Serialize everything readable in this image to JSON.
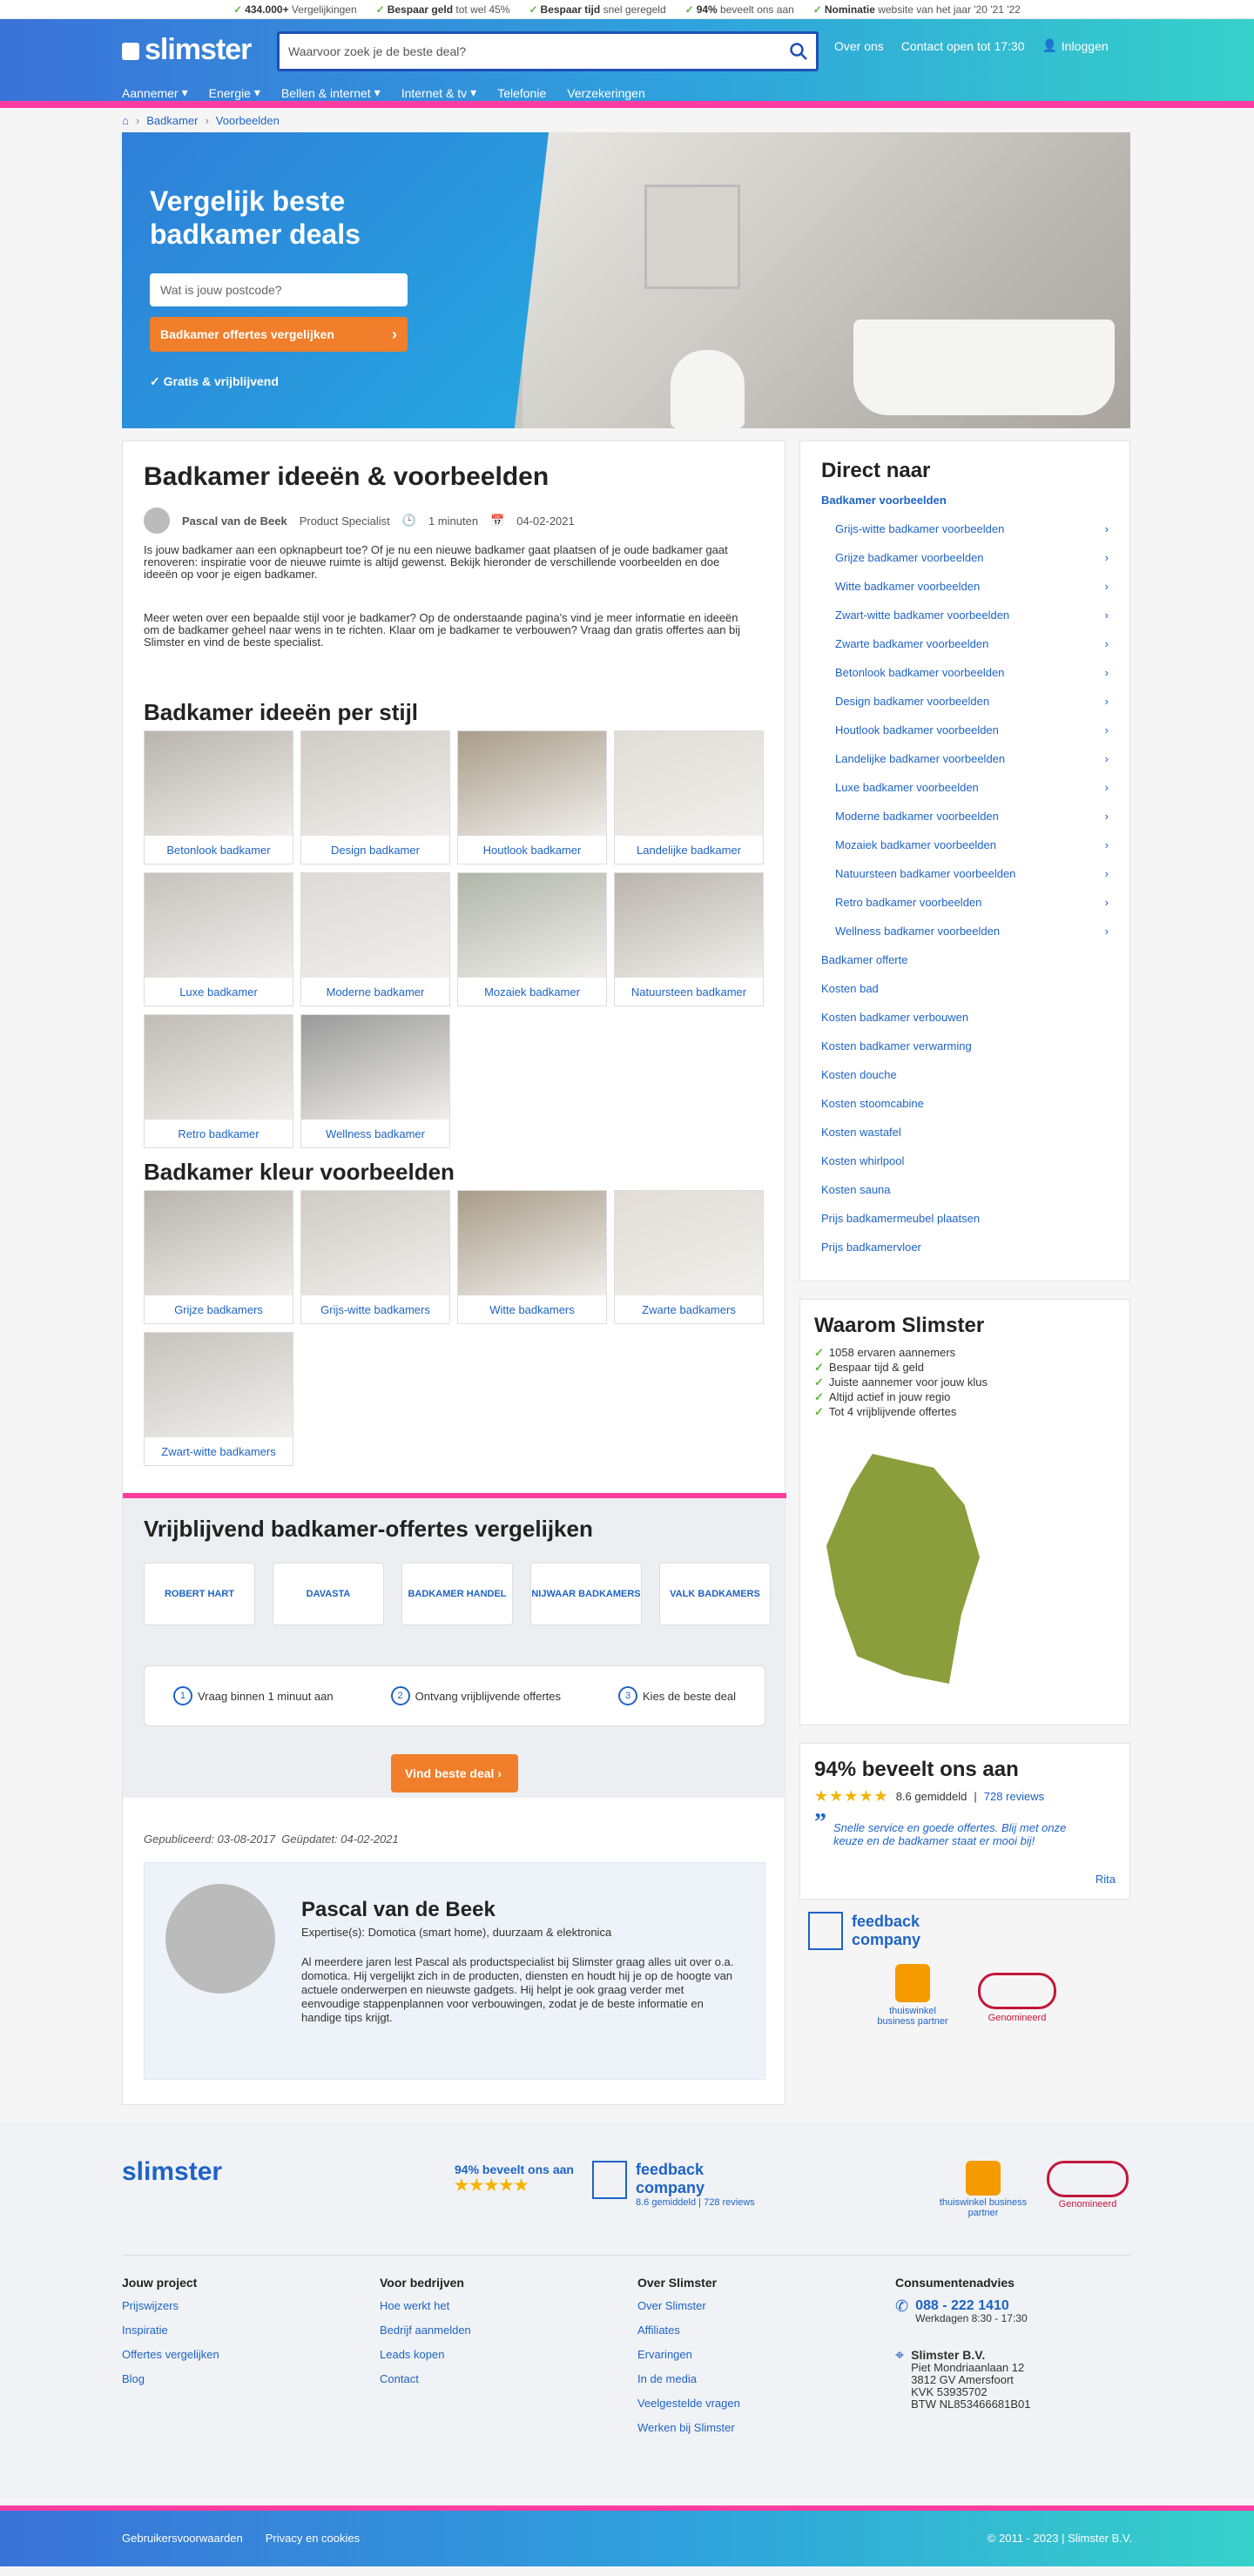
{
  "topbar": [
    {
      "bold": "434.000+",
      "text": " Vergelijkingen"
    },
    {
      "bold": "Bespaar geld",
      "text": " tot wel 45%"
    },
    {
      "bold": "Bespaar tijd",
      "text": " snel geregeld"
    },
    {
      "bold": "94%",
      "text": " beveelt ons aan"
    },
    {
      "bold": "Nominatie",
      "text": " website van het jaar '20 '21 '22"
    }
  ],
  "header": {
    "logo": "slimster",
    "search_placeholder": "Waarvoor zoek je de beste deal?",
    "links": [
      "Over ons",
      "Contact open tot 17:30",
      "Inloggen"
    ],
    "nav": [
      "Aannemer",
      "Energie",
      "Bellen & internet",
      "Internet & tv",
      "Telefonie",
      "Verzekeringen"
    ]
  },
  "breadcrumb": [
    "Badkamer",
    "Voorbeelden"
  ],
  "hero": {
    "title": "Vergelijk beste badkamer deals",
    "postcode_placeholder": "Wat is jouw postcode?",
    "cta": "Badkamer offertes vergelijken",
    "free": "Gratis & vrijblijvend"
  },
  "article": {
    "title": "Badkamer ideeën & voorbeelden",
    "author": "Pascal van de Beek",
    "role": "Product Specialist",
    "read": "1 minuten",
    "date": "04-02-2021",
    "intro1": "Is jouw badkamer aan een opknapbeurt toe? Of je nu een nieuwe badkamer gaat plaatsen of je oude badkamer gaat renoveren: inspiratie voor de nieuwe ruimte is altijd gewenst. Bekijk hieronder de verschillende voorbeelden en doe ideeën op voor je eigen badkamer.",
    "intro2": "Meer weten over een bepaalde stijl voor je badkamer? Op de onderstaande pagina's vind je meer informatie en ideeën om de badkamer geheel naar wens in te richten. Klaar om je badkamer te verbouwen? Vraag dan gratis offertes aan bij Slimster en vind de beste specialist.",
    "styles_title": "Badkamer ideeën per stijl",
    "styles": [
      "Betonlook badkamer",
      "Design badkamer",
      "Houtlook badkamer",
      "Landelijke badkamer",
      "Luxe badkamer",
      "Moderne badkamer",
      "Mozaiek badkamer",
      "Natuursteen badkamer",
      "Retro badkamer",
      "Wellness badkamer"
    ],
    "colors_title": "Badkamer kleur voorbeelden",
    "colors": [
      "Grijze badkamers",
      "Grijs-witte badkamers",
      "Witte badkamers",
      "Zwarte badkamers",
      "Zwart-witte badkamers"
    ]
  },
  "offer": {
    "title": "Vrijblijvend badkamer-offertes vergelijken",
    "logos": [
      "ROBERT HART",
      "DAVASTA",
      "BADKAMER HANDEL",
      "NIJWAAR BADKAMERS",
      "VALK BADKAMERS"
    ],
    "steps": [
      "Vraag binnen 1 minuut aan",
      "Ontvang vrijblijvende offertes",
      "Kies de beste deal"
    ],
    "step_nums": [
      "1",
      "2",
      "3"
    ],
    "button": "Vind beste deal"
  },
  "meta": {
    "published": "Gepubliceerd: 03-08-2017",
    "updated": "Geüpdatet: 04-02-2021"
  },
  "bio": {
    "name": "Pascal van de Beek",
    "expertise": "Expertise(s): Domotica (smart home), duurzaam & elektronica",
    "text": "Al meerdere jaren lest Pascal als productspecialist bij Slimster graag alles uit over o.a. domotica. Hij vergelijkt zich in de producten, diensten en houdt hij je op de hoogte van actuele onderwerpen en nieuwste gadgets. Hij helpt je ook graag verder met eenvoudige stappenplannen voor verbouwingen, zodat je de beste informatie en handige tips krijgt."
  },
  "sidebar": {
    "direct_title": "Direct naar",
    "direct_sub": "Badkamer voorbeelden",
    "indented": [
      "Grijs-witte badkamer voorbeelden",
      "Grijze badkamer voorbeelden",
      "Witte badkamer voorbeelden",
      "Zwart-witte badkamer voorbeelden",
      "Zwarte badkamer voorbeelden",
      "Betonlook badkamer voorbeelden",
      "Design badkamer voorbeelden",
      "Houtlook badkamer voorbeelden",
      "Landelijke badkamer voorbeelden",
      "Luxe badkamer voorbeelden",
      "Moderne badkamer voorbeelden",
      "Mozaiek badkamer voorbeelden",
      "Natuursteen badkamer voorbeelden",
      "Retro badkamer voorbeelden",
      "Wellness badkamer voorbeelden"
    ],
    "links": [
      "Badkamer offerte",
      "Kosten bad",
      "Kosten badkamer verbouwen",
      "Kosten badkamer verwarming",
      "Kosten douche",
      "Kosten stoomcabine",
      "Kosten wastafel",
      "Kosten whirlpool",
      "Kosten sauna",
      "Prijs badkamermeubel plaatsen",
      "Prijs badkamervloer"
    ],
    "why_title": "Waarom Slimster",
    "why": [
      "1058 ervaren aannemers",
      "Bespaar tijd & geld",
      "Juiste aannemer voor jouw klus",
      "Altijd actief in jouw regio",
      "Tot 4 vrijblijvende offertes"
    ],
    "reviews_title": "94% beveelt ons aan",
    "rating": "8.6 gemiddeld",
    "review_count": "728 reviews",
    "quote": "Snelle service en goede offertes. Blij met onze keuze en de badkamer staat er mooi bij!",
    "quote_author": "Rita",
    "feedback": "feedback company",
    "thuiswinkel": "thuiswinkel business partner",
    "genomineerd": "Genomineerd"
  },
  "footer": {
    "logo": "slimster",
    "recommend": "94% beveelt ons aan",
    "cols": [
      {
        "title": "Jouw project",
        "links": [
          "Prijswijzers",
          "Inspiratie",
          "Offertes vergelijken",
          "Blog"
        ]
      },
      {
        "title": "Voor bedrijven",
        "links": [
          "Hoe werkt het",
          "Bedrijf aanmelden",
          "Leads kopen",
          "Contact"
        ]
      },
      {
        "title": "Over Slimster",
        "links": [
          "Over Slimster",
          "Affiliates",
          "Ervaringen",
          "In de media",
          "Veelgestelde vragen",
          "Werken bij Slimster"
        ]
      }
    ],
    "contact_title": "Consumentenadvies",
    "phone": "088 - 222 1410",
    "hours": "Werkdagen 8:30 - 17:30",
    "company": "Slimster B.V.",
    "address": [
      "Piet Mondriaanlaan 12",
      "3812 GV Amersfoort",
      "KVK 53935702",
      "BTW NL853466681B01"
    ],
    "bottom_links": [
      "Gebruikersvoorwaarden",
      "Privacy en cookies"
    ],
    "copyright": "© 2011 - 2023 | Slimster B.V."
  }
}
